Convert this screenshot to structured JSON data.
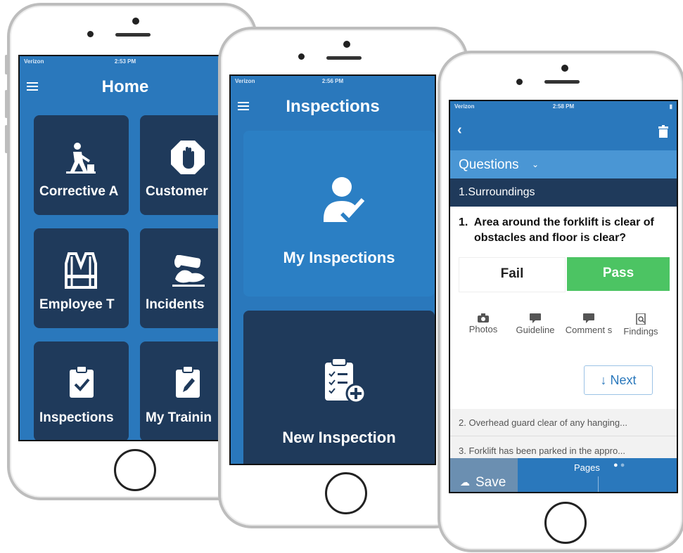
{
  "phone1": {
    "status": {
      "carrier": "Verizon",
      "time": "2:53 PM"
    },
    "title": "Home",
    "tiles": [
      {
        "label": "Corrective A",
        "icon": "worker-icon"
      },
      {
        "label": "Customer",
        "icon": "stop-hand-icon"
      },
      {
        "label": "Employee T",
        "icon": "vest-icon"
      },
      {
        "label": "Incidents",
        "icon": "spill-icon"
      },
      {
        "label": "Inspections",
        "icon": "clipboard-check-icon"
      },
      {
        "label": "My Trainin",
        "icon": "clipboard-pen-icon"
      }
    ]
  },
  "phone2": {
    "status": {
      "carrier": "Verizon",
      "time": "2:56 PM"
    },
    "title": "Inspections",
    "tiles": [
      {
        "label": "My Inspections",
        "icon": "user-check-icon"
      },
      {
        "label": "New Inspection",
        "icon": "clipboard-add-icon"
      }
    ]
  },
  "phone3": {
    "status": {
      "carrier": "Verizon",
      "time": "2:58 PM"
    },
    "questions_label": "Questions",
    "section": "1.Surroundings",
    "question": {
      "number": "1.",
      "text_line1": "Area around the forklift is clear of",
      "text_line2": "obstacles and floor is clear?"
    },
    "fail_label": "Fail",
    "pass_label": "Pass",
    "tools": [
      {
        "label": "Photos",
        "icon": "camera-icon"
      },
      {
        "label": "Guideline",
        "icon": "comment-icon"
      },
      {
        "label": "Comment s",
        "icon": "comment-icon"
      },
      {
        "label": "Findings",
        "icon": "findings-icon"
      }
    ],
    "next_label": "↓ Next",
    "next_questions": [
      "2. Overhead guard clear of any hanging...",
      "3. Forklift has been parked in the appro..."
    ],
    "pages_label": "Pages",
    "save_label": "Save",
    "colors": {
      "pass": "#4cc463",
      "header": "#2a78bc",
      "section": "#1f3a5b"
    }
  }
}
